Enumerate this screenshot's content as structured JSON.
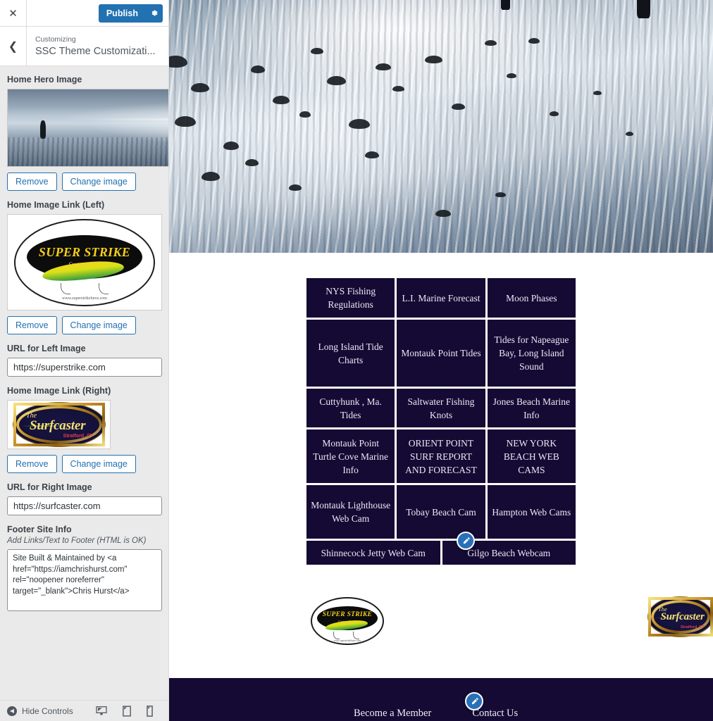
{
  "customizer": {
    "close_label": "✕",
    "publish_label": "Publish",
    "gear_icon": "gear-icon",
    "back_icon": "chevron-left-icon",
    "eyebrow": "Customizing",
    "title": "SSC Theme Customizati...",
    "accent_color": "#2271b1"
  },
  "controls": {
    "hero": {
      "label": "Home Hero Image",
      "remove_label": "Remove",
      "change_label": "Change image"
    },
    "left_image": {
      "label": "Home Image Link (Left)",
      "remove_label": "Remove",
      "change_label": "Change image"
    },
    "left_url": {
      "label": "URL for Left Image",
      "value": "https://superstrike.com"
    },
    "right_image": {
      "label": "Home Image Link (Right)",
      "remove_label": "Remove",
      "change_label": "Change image"
    },
    "right_url": {
      "label": "URL for Right Image",
      "value": "https://surfcaster.com"
    },
    "footer_info": {
      "label": "Footer Site Info",
      "description": "Add Links/Text to Footer (HTML is OK)",
      "value": "Site Built & Maintained by <a href=\"https://iamchrishurst.com\" rel=\"noopener noreferrer\" target=\"_blank\">Chris Hurst</a>"
    }
  },
  "bottom_bar": {
    "hide_controls_label": "Hide Controls",
    "devices": [
      "desktop-icon",
      "tablet-icon",
      "mobile-icon"
    ]
  },
  "preview": {
    "tile_color": "#140a33",
    "tile_text_color": "#eae7f5",
    "edit_icon": "pencil-icon",
    "link_rows": [
      {
        "cols": 3,
        "tiles": [
          "NYS Fishing Regulations",
          "L.I. Marine Forecast",
          "Moon Phases"
        ]
      },
      {
        "cols": 3,
        "tiles": [
          "Long Island Tide Charts",
          "Montauk Point Tides",
          "Tides for Napeague Bay, Long Island Sound"
        ]
      },
      {
        "cols": 3,
        "tiles": [
          "Cuttyhunk , Ma. Tides",
          "Saltwater Fishing Knots",
          "Jones Beach Marine Info"
        ]
      },
      {
        "cols": 3,
        "tiles": [
          "Montauk Point Turtle Cove Marine Info",
          "ORIENT POINT SURF REPORT AND FORECAST",
          "NEW YORK BEACH WEB CAMS"
        ]
      },
      {
        "cols": 3,
        "tiles": [
          "Montauk Lighthouse Web Cam",
          "Tobay Beach Cam",
          "Hampton Web Cams"
        ]
      },
      {
        "cols": 2,
        "tiles": [
          "Shinnecock Jetty Web Cam",
          "Gilgo Beach Webcam"
        ]
      }
    ],
    "sponsors": {
      "left": {
        "name": "super-strike-logo",
        "title": "SUPER STRIKE",
        "subtitle": "Custom Lures",
        "url": "www.superstrikelures.com"
      },
      "right": {
        "name": "surfcaster-logo",
        "the": "The",
        "title": "Surfcaster",
        "subtitle": "Stratford, CT"
      }
    },
    "footer_links": [
      "Become a Member",
      "Contact Us"
    ]
  }
}
